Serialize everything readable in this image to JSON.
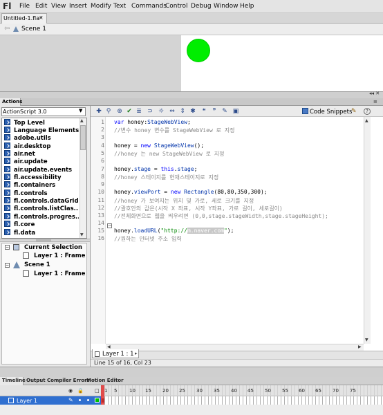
{
  "app": {
    "logo": "Fl",
    "menu": [
      "File",
      "Edit",
      "View",
      "Insert",
      "Modify",
      "Text",
      "Commands",
      "Control",
      "Debug",
      "Window",
      "Help"
    ]
  },
  "document": {
    "tab_title": "Untitled-1.fla*",
    "close": "×"
  },
  "scene_bar": {
    "scene": "Scene 1"
  },
  "stage": {
    "circle_color": "#00ee00",
    "background": "#ffffff"
  },
  "actions_panel": {
    "tab": "Actions",
    "language": "ActionScript 3.0",
    "library_items": [
      "Top Level",
      "Language Elements",
      "adobe.utils",
      "air.desktop",
      "air.net",
      "air.update",
      "air.update.events",
      "fl.accessibility",
      "fl.containers",
      "fl.controls",
      "fl.controls.dataGrid...",
      "fl.controls.listClas...",
      "fl.controls.progres...",
      "fl.core",
      "fl.data"
    ],
    "scene_tree": {
      "current_selection": "Current Selection",
      "current_layer": "Layer 1 : Frame",
      "scene": "Scene 1",
      "scene_layer": "Layer 1 : Frame"
    },
    "toolbar": {
      "code_snippets": "Code Snippets"
    },
    "code_lines": [
      "var honey:StageWebView;",
      "//변수 honey 변수를 StageWebView 로 지정",
      "",
      "honey = new StageWebView();",
      "//honey 는 new StageWebView 로 지정",
      "",
      "honey.stage = this.stage;",
      "//honey 스테이지를 현재스테이지로 지정",
      "",
      "honey.viewPort = new Rectangle(80,80,350,300);",
      "//honey 가 보여지는 위치 및 가로, 세로 크기를 지정",
      "//괄호안의 값은(시작 X 좌표, 시작 Y좌표, 가로 길이, 세로길이)",
      "//전체화면으로 웹을 띄우려면 (0,0,stage.stageWidth,stage.stageHeight);",
      "",
      "honey.loadURL(\"http://m.naver.com\");",
      "//원하는 인터넷 주소 입력"
    ],
    "line_numbers": [
      "1",
      "2",
      "3",
      "4",
      "5",
      "6",
      "7",
      "8",
      "9",
      "10",
      "11",
      "12",
      "13",
      "14",
      "15",
      "16"
    ],
    "script_tab": "Layer 1 : 1",
    "status": "Line 15 of 16, Col 23"
  },
  "timeline": {
    "tabs": [
      "Timeline",
      "Output",
      "Compiler Errors",
      "Motion Editor"
    ],
    "ruler": [
      "1",
      "5",
      "10",
      "15",
      "20",
      "25",
      "30",
      "35",
      "40",
      "45",
      "50",
      "55",
      "60",
      "65",
      "70",
      "75"
    ],
    "layer": "Layer 1",
    "layer_color": "#00c000"
  }
}
